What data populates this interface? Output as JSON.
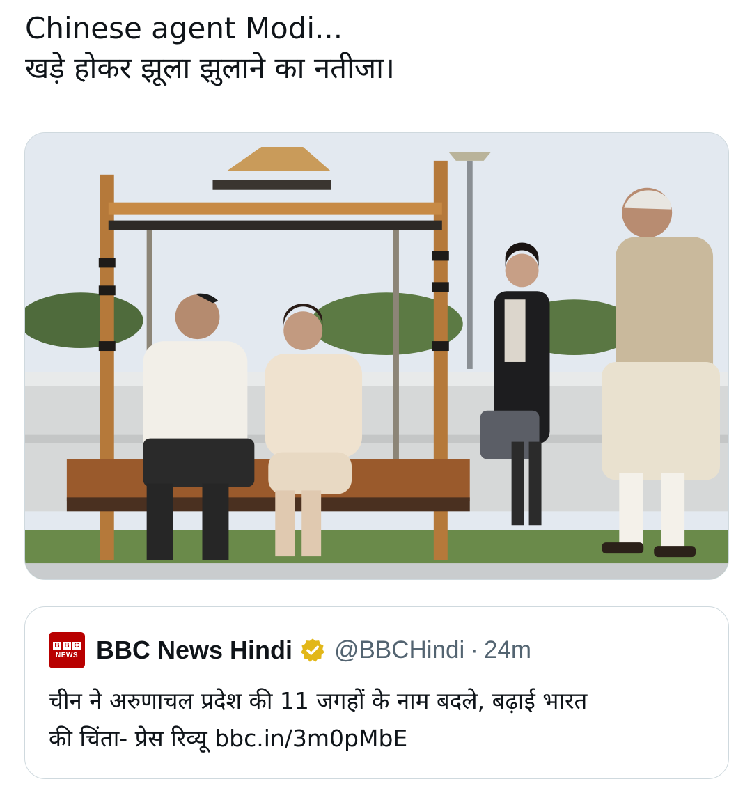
{
  "tweet": {
    "lines": [
      "Chinese agent Modi...",
      "खड़े होकर झूला झुलाने का नतीजा।"
    ]
  },
  "media": {
    "icon": "photo-swing-meeting"
  },
  "quote": {
    "author_name": "BBC News Hindi",
    "handle": "@BBCHindi",
    "separator": "·",
    "time": "24m",
    "logo_blocks": [
      "B",
      "B",
      "C"
    ],
    "logo_text": "NEWS",
    "text_line1": "चीन ने अरुणाचल प्रदेश की 11 जगहों के नाम बदले, बढ़ाई भारत",
    "text_line2_prefix": "की चिंता- प्रेस रिव्यू ",
    "link": "bbc.in/3m0pMbE"
  },
  "colors": {
    "text": "#0f1419",
    "secondary": "#536471",
    "border": "#cfd9de",
    "bbc_red": "#b80000",
    "verified_gold": "#e2b719"
  }
}
